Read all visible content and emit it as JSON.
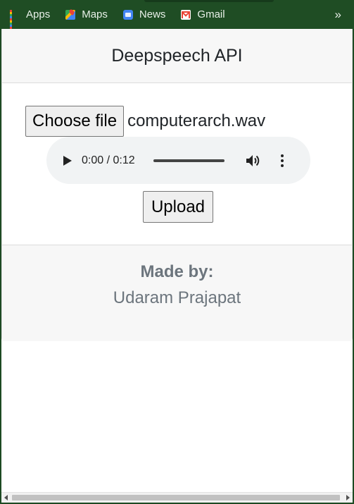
{
  "bookmarks": {
    "items": [
      {
        "label": "Apps",
        "icon": "apps-icon"
      },
      {
        "label": "Maps",
        "icon": "maps-icon"
      },
      {
        "label": "News",
        "icon": "news-icon"
      },
      {
        "label": "Gmail",
        "icon": "gmail-icon"
      }
    ],
    "more_label": "»"
  },
  "card": {
    "title": "Deepspeech API",
    "file_input": {
      "button_label": "Choose file",
      "file_name": "computerarch.wav"
    },
    "audio_player": {
      "time_display": "0:00 / 0:12",
      "progress": 0
    },
    "upload_label": "Upload",
    "footer": {
      "made_by_label": "Made by:",
      "author": "Udaram Prajapat"
    }
  },
  "colors": {
    "browser_frame": "#1f4d24",
    "header_bg": "#f7f7f7",
    "footer_text": "#6c757d"
  }
}
